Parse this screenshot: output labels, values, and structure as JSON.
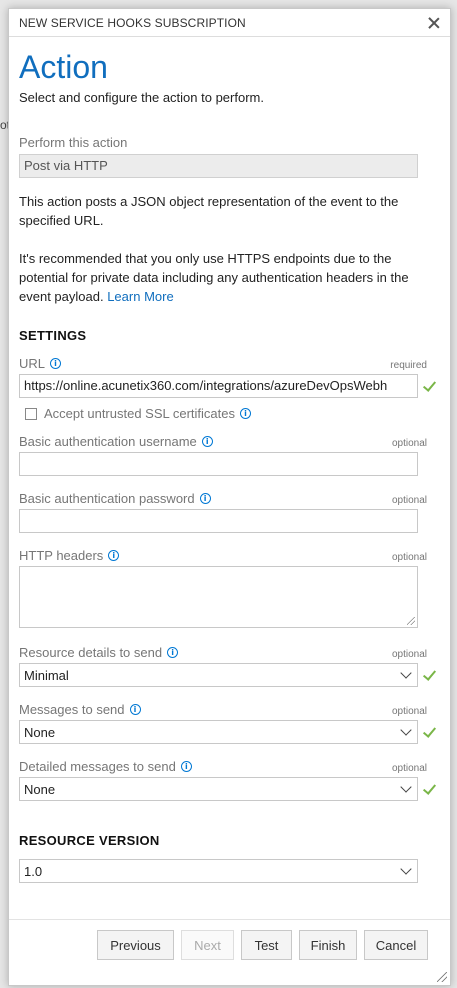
{
  "background_fragment": "ot",
  "dialog": {
    "title": "NEW SERVICE HOOKS SUBSCRIPTION",
    "heading": "Action",
    "subtitle": "Select and configure the action to perform."
  },
  "perform": {
    "label": "Perform this action",
    "value": "Post via HTTP"
  },
  "description": {
    "para1": "This action posts a JSON object representation of the event to the specified URL.",
    "para2": "It's recommended that you only use HTTPS endpoints due to the potential for private data including any authentication headers in the event payload.",
    "learn_more": "Learn More"
  },
  "settings": {
    "title": "SETTINGS",
    "url": {
      "label": "URL",
      "tag": "required",
      "value": "https://online.acunetix360.com/integrations/azureDevOpsWebh"
    },
    "ssl": {
      "label": "Accept untrusted SSL certificates",
      "checked": false
    },
    "username": {
      "label": "Basic authentication username",
      "tag": "optional",
      "value": ""
    },
    "password": {
      "label": "Basic authentication password",
      "tag": "optional",
      "value": ""
    },
    "headers": {
      "label": "HTTP headers",
      "tag": "optional",
      "value": ""
    },
    "resource_details": {
      "label": "Resource details to send",
      "tag": "optional",
      "value": "Minimal"
    },
    "messages": {
      "label": "Messages to send",
      "tag": "optional",
      "value": "None"
    },
    "detailed_messages": {
      "label": "Detailed messages to send",
      "tag": "optional",
      "value": "None"
    }
  },
  "resource_version": {
    "title": "RESOURCE VERSION",
    "value": "1.0"
  },
  "footer": {
    "previous": "Previous",
    "next": "Next",
    "test": "Test",
    "finish": "Finish",
    "cancel": "Cancel"
  },
  "colors": {
    "accent": "#106ebe",
    "valid_check": "#7ab648",
    "info": "#0078d4"
  }
}
